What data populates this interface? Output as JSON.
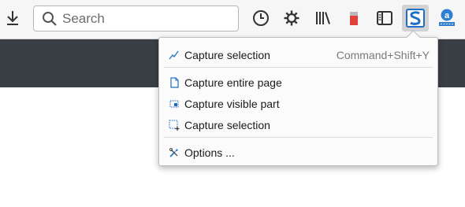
{
  "toolbar": {
    "search": {
      "placeholder": "Search",
      "value": ""
    },
    "icons": [
      {
        "name": "download-icon"
      },
      {
        "name": "history-icon"
      },
      {
        "name": "settings-gear-icon"
      },
      {
        "name": "library-icon"
      },
      {
        "name": "extension-red-icon"
      },
      {
        "name": "sidebar-icon"
      },
      {
        "name": "screenshot-extension-icon",
        "active": true
      },
      {
        "name": "account-extension-icon"
      }
    ]
  },
  "menu": {
    "items": [
      {
        "label": "Capture selection",
        "shortcut": "Command+Shift+Y",
        "icon": "capture-selection-pen-icon"
      },
      {
        "label": "Capture entire page",
        "icon": "page-icon"
      },
      {
        "label": "Capture visible part",
        "icon": "visible-part-icon"
      },
      {
        "label": "Capture selection",
        "icon": "selection-dashed-icon"
      },
      {
        "label": "Options ...",
        "icon": "options-tools-icon"
      }
    ]
  },
  "colors": {
    "toolbar_bg": "#f6f6f6",
    "dark_band": "#3a3e45",
    "accent_blue": "#1f6fc5",
    "menu_bg": "#fbfbfb"
  }
}
